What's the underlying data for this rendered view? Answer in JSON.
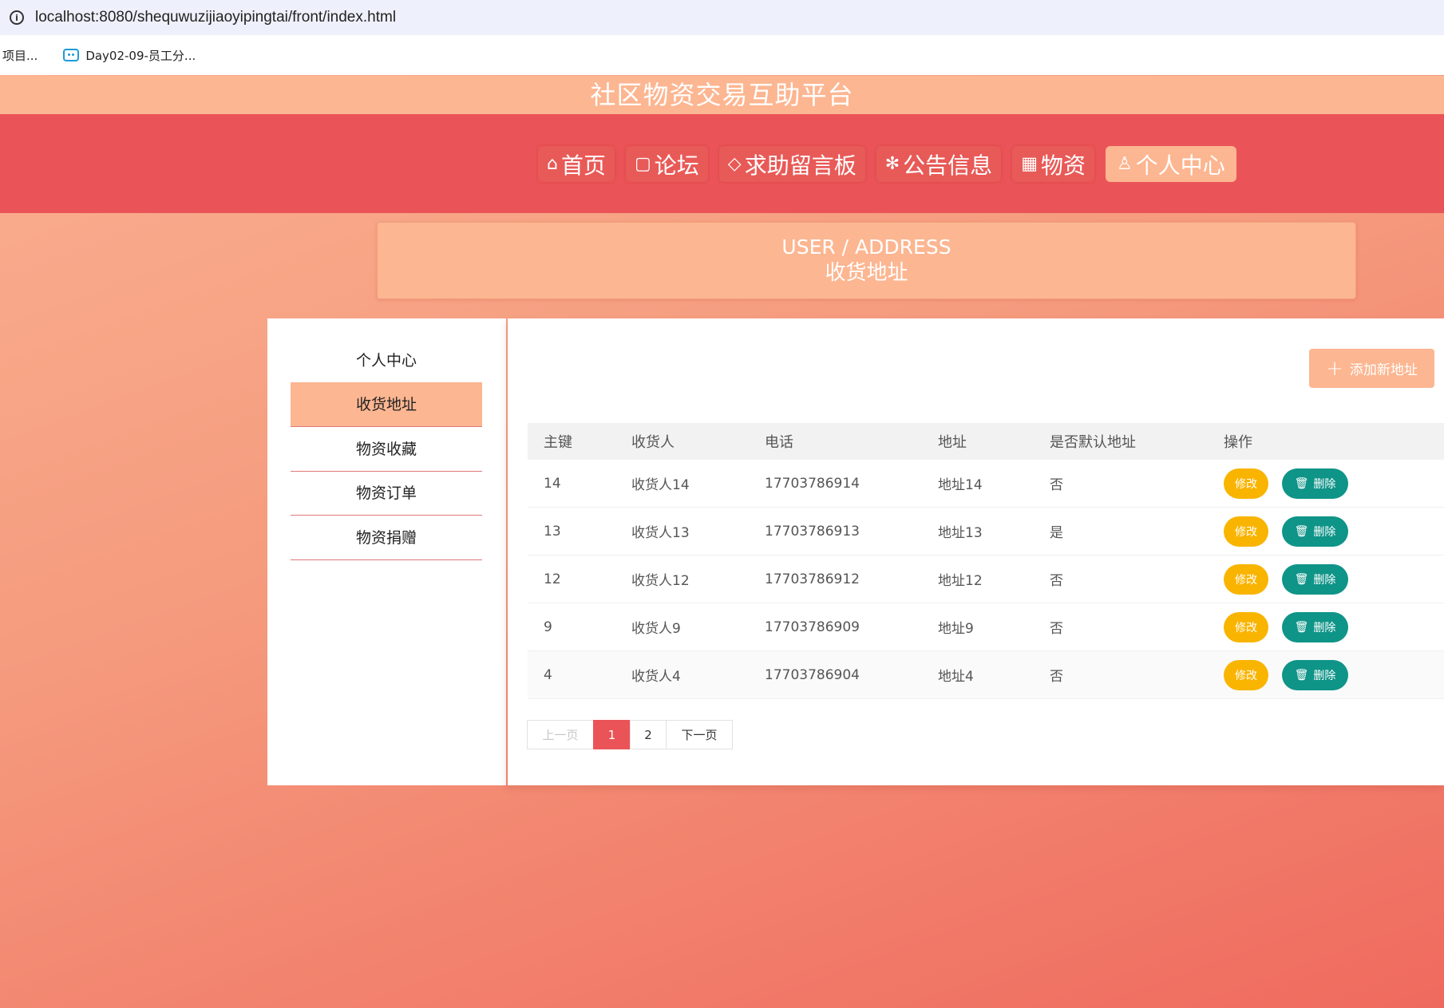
{
  "browser": {
    "url": "localhost:8080/shequwuzijiaoyipingtai/front/index.html",
    "bookmarks": [
      "项目...",
      "Day02-09-员工分..."
    ]
  },
  "site": {
    "title": "社区物资交易互助平台"
  },
  "nav": {
    "items": [
      {
        "icon": "⌂",
        "label": "首页",
        "active": false
      },
      {
        "icon": "▢",
        "label": "论坛",
        "active": false
      },
      {
        "icon": "◇",
        "label": "求助留言板",
        "active": false
      },
      {
        "icon": "✻",
        "label": "公告信息",
        "active": false
      },
      {
        "icon": "▦",
        "label": "物资",
        "active": false
      },
      {
        "icon": "♙",
        "label": "个人中心",
        "active": true
      }
    ]
  },
  "breadcrumb": {
    "en": "USER / ADDRESS",
    "cn": "收货地址"
  },
  "sidebar": {
    "items": [
      "个人中心",
      "收货地址",
      "物资收藏",
      "物资订单",
      "物资捐赠"
    ],
    "active_index": 1
  },
  "main": {
    "add_button": "添加新地址",
    "table": {
      "headers": [
        "主键",
        "收货人",
        "电话",
        "地址",
        "是否默认地址",
        "操作"
      ],
      "rows": [
        {
          "id": "14",
          "name": "收货人14",
          "phone": "17703786914",
          "address": "地址14",
          "default": "否"
        },
        {
          "id": "13",
          "name": "收货人13",
          "phone": "17703786913",
          "address": "地址13",
          "default": "是"
        },
        {
          "id": "12",
          "name": "收货人12",
          "phone": "17703786912",
          "address": "地址12",
          "default": "否"
        },
        {
          "id": "9",
          "name": "收货人9",
          "phone": "17703786909",
          "address": "地址9",
          "default": "否"
        },
        {
          "id": "4",
          "name": "收货人4",
          "phone": "17703786904",
          "address": "地址4",
          "default": "否"
        }
      ],
      "edit_label": "修改",
      "delete_label": "删除"
    },
    "pager": {
      "prev": "上一页",
      "pages": [
        "1",
        "2"
      ],
      "current": "1",
      "next": "下一页"
    }
  },
  "colors": {
    "accent": "#fcb691",
    "nav_bg": "#ea5458",
    "edit": "#f9b400",
    "delete": "#0f9488"
  }
}
